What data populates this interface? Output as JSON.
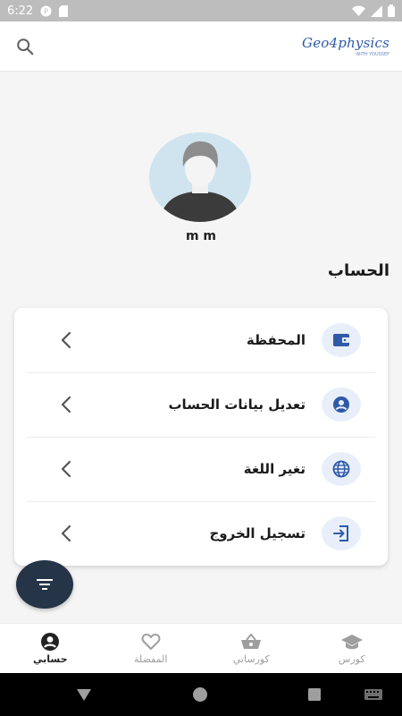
{
  "status_bar": {
    "time": "6:22"
  },
  "app_bar": {
    "logo_text": "Geo4physics",
    "logo_subtitle": "WITH YOUSSEF"
  },
  "profile": {
    "name": "m m"
  },
  "section": {
    "title": "الحساب"
  },
  "menu": {
    "items": [
      {
        "label": "المحفظة",
        "icon": "wallet-icon"
      },
      {
        "label": "تعديل بيانات الحساب",
        "icon": "account-circle-icon"
      },
      {
        "label": "تغير اللغة",
        "icon": "globe-icon"
      },
      {
        "label": "تسجيل الخروج",
        "icon": "logout-icon"
      }
    ]
  },
  "bottom_nav": {
    "items": [
      {
        "label": "حسابي",
        "icon": "account-icon",
        "active": true
      },
      {
        "label": "المفضلة",
        "icon": "heart-icon",
        "active": false
      },
      {
        "label": "كورساتي",
        "icon": "basket-icon",
        "active": false
      },
      {
        "label": "كورس",
        "icon": "graduation-cap-icon",
        "active": false
      }
    ]
  },
  "colors": {
    "accent": "#2f5aa8",
    "icon_bg": "#e8effa",
    "fab": "#253447",
    "avatar_bg": "#cfe4ef"
  }
}
